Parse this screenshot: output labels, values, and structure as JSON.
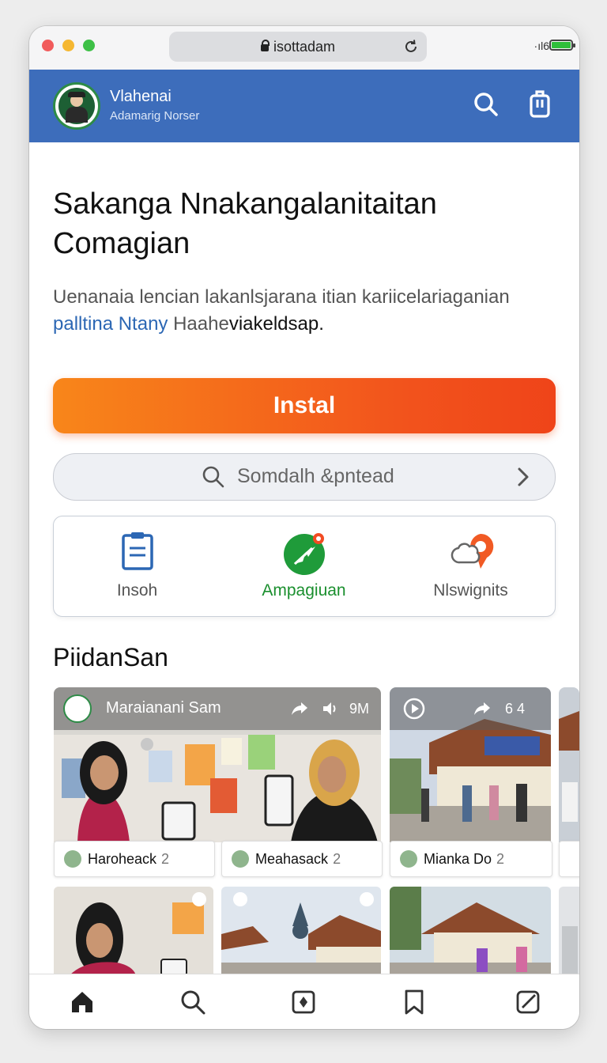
{
  "browser": {
    "url": "isottadam",
    "signal": "·ıl6"
  },
  "app": {
    "title": "Vlahenai",
    "subtitle": "Adamarig Norser"
  },
  "hero": {
    "heading_line1": "Sakanga Nnakangalanitaitan",
    "heading_line2": "Comagian",
    "desc_line1": "Uenanaia lencian lakanlsjarana itian kariicelariaganian",
    "desc_link": "palltina Ntany",
    "desc_rest_gray": " Haahe",
    "desc_rest_dark": "viakeldsap."
  },
  "install_button": {
    "label": "Instal"
  },
  "search": {
    "placeholder": "Somdalh &pntead"
  },
  "actions": [
    {
      "label": "Insoh",
      "icon": "clipboard-icon",
      "color": "#555555"
    },
    {
      "label": "Ampagiuan",
      "icon": "send-icon",
      "color": "#1a8f2e"
    },
    {
      "label": "Nlswignits",
      "icon": "chat-bubble-icon",
      "color": "#555555"
    }
  ],
  "section": {
    "title": "PiidanSan"
  },
  "feed": {
    "featured": {
      "title": "Maraianani Sam",
      "meta": "9M"
    },
    "second": {
      "meta": "6 4"
    },
    "tags": [
      {
        "name": "Haroheack",
        "count": "2"
      },
      {
        "name": "Meahasack",
        "count": "2"
      },
      {
        "name": "Mianka Do",
        "count": "2"
      }
    ]
  },
  "colors": {
    "header_blue": "#3d6dbb",
    "install_orange_start": "#f8861a",
    "install_orange_end": "#ef4419",
    "link_blue": "#2c67b4",
    "green": "#1a8f2e"
  },
  "bottom_nav": [
    "home-icon",
    "search-icon",
    "compose-icon",
    "bookmark-icon",
    "edit-icon"
  ]
}
